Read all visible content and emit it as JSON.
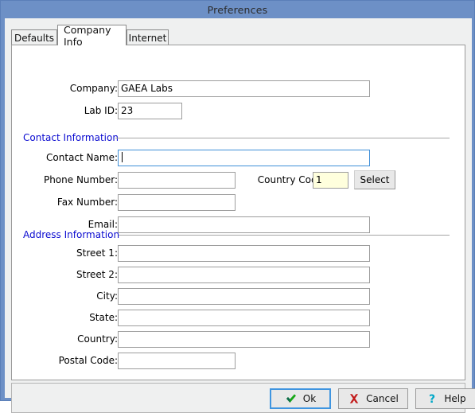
{
  "window": {
    "title": "Preferences",
    "titlebar_color": "#6d90c6"
  },
  "tabs": [
    {
      "label": "Defaults",
      "active": false
    },
    {
      "label": "Company Info",
      "active": true
    },
    {
      "label": "Internet",
      "active": false
    }
  ],
  "form": {
    "company": {
      "label": "Company:",
      "value": "GAEA Labs"
    },
    "lab_id": {
      "label": "Lab ID:",
      "value": "23"
    }
  },
  "sections": {
    "contact": {
      "label": "Contact Information"
    },
    "address": {
      "label": "Address Information"
    }
  },
  "contact": {
    "contact_name": {
      "label": "Contact Name:",
      "value": ""
    },
    "phone_number": {
      "label": "Phone Number:",
      "value": ""
    },
    "country_code": {
      "label": "Country Code:",
      "value": "1"
    },
    "select_button": {
      "label": "Select"
    },
    "fax_number": {
      "label": "Fax Number:",
      "value": ""
    },
    "email": {
      "label": "Email:",
      "value": ""
    }
  },
  "address": {
    "street1": {
      "label": "Street 1:",
      "value": ""
    },
    "street2": {
      "label": "Street 2:",
      "value": ""
    },
    "city": {
      "label": "City:",
      "value": ""
    },
    "state": {
      "label": "State:",
      "value": ""
    },
    "country": {
      "label": "Country:",
      "value": ""
    },
    "postal_code": {
      "label": "Postal Code:",
      "value": ""
    }
  },
  "buttons": {
    "ok": {
      "label": "Ok",
      "icon": "green-check-icon"
    },
    "cancel": {
      "label": "Cancel",
      "icon": "red-x-icon"
    },
    "help": {
      "label": "Help",
      "icon": "question-mark-icon"
    }
  },
  "colors": {
    "titlebar": "#6d90c6",
    "section_label": "#0a0ad0",
    "focus_border": "#3f8fd8",
    "country_code_bg": "#ffffdd",
    "ok_icon": "#11a811",
    "cancel_icon": "#cc1111",
    "help_icon": "#00a8c8"
  }
}
